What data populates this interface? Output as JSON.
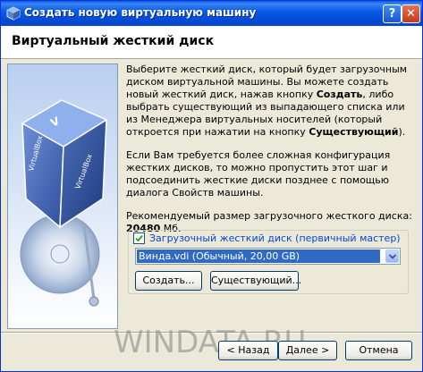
{
  "window": {
    "title": "Создать новую виртуальную машину",
    "help_button": "?",
    "close_button": "✕"
  },
  "header": {
    "title": "Виртуальный жесткий диск"
  },
  "content": {
    "para1": [
      {
        "text": "Выберите жесткий диск, который будет загрузочным диском виртуальной машины. Вы можете создать новый жесткий диск, нажав кнопку "
      },
      {
        "text": "Создать",
        "bold": true
      },
      {
        "text": ", либо выбрать существующий из выпадающего списка или из Менеджера виртуальных носителей (который откроется при нажатии на кнопку "
      },
      {
        "text": "Существующий",
        "bold": true
      },
      {
        "text": ")."
      }
    ],
    "para2": "Если Вам требуется более сложная конфигурация жестких дисков, то можно пропустить этот шаг и подсоединить жесткие диски позднее с помощью диалога Свойств машины.",
    "recommended_prefix": "Рекомендуемый размер загрузочного жесткого диска: ",
    "recommended_size": "20480",
    "recommended_unit": " Мб."
  },
  "boot_disk": {
    "checkbox_label": "Загрузочный жесткий диск (первичный мастер)",
    "checked": true,
    "selected_value": "Винда.vdi (Обычный, 20,00 GB)",
    "create_button": "Создать...",
    "existing_button": "Существующий..."
  },
  "footer": {
    "back_button": "< Назад",
    "next_button": "Далее >",
    "cancel_button": "Отмена"
  },
  "watermark": "WINDATA.RU",
  "colors": {
    "title_bar": "#0a5ce6",
    "dialog_bg": "#ece9d8",
    "selection": "#316ac5",
    "checkbox_label": "#0046d5"
  },
  "icons": {
    "title": "virtualbox-app-icon",
    "side_art": "virtualbox-cube-disk-icon"
  }
}
